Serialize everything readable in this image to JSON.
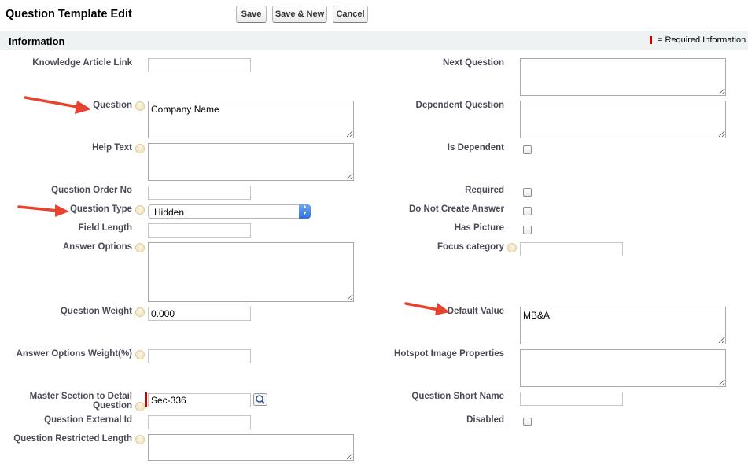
{
  "header": {
    "title": "Question Template Edit",
    "save_label": "Save",
    "save_new_label": "Save & New",
    "cancel_label": "Cancel"
  },
  "section": {
    "title": "Information",
    "required_legend": "= Required Information",
    "required_color": "#cc0000"
  },
  "left_fields": {
    "knowledge_article_link": {
      "label": "Knowledge Article Link",
      "value": ""
    },
    "question": {
      "label": "Question",
      "value": "Company Name"
    },
    "help_text": {
      "label": "Help Text",
      "value": ""
    },
    "question_order_no": {
      "label": "Question Order No",
      "value": ""
    },
    "question_type": {
      "label": "Question Type",
      "value": "Hidden"
    },
    "field_length": {
      "label": "Field Length",
      "value": ""
    },
    "answer_options": {
      "label": "Answer Options",
      "value": ""
    },
    "question_weight": {
      "label": "Question Weight",
      "value": "0.000"
    },
    "answer_options_weight": {
      "label": "Answer Options Weight(%)",
      "value": ""
    },
    "master_section_line1": "Master Section to Detail",
    "master_section_line2": "Question",
    "master_section_value": "Sec-336",
    "question_external_id": {
      "label": "Question External Id",
      "value": ""
    },
    "question_restricted_length": {
      "label": "Question Restricted Length",
      "value": ""
    }
  },
  "right_fields": {
    "next_question": {
      "label": "Next Question",
      "value": ""
    },
    "dependent_question": {
      "label": "Dependent Question",
      "value": ""
    },
    "is_dependent": {
      "label": "Is Dependent"
    },
    "required": {
      "label": "Required"
    },
    "do_not_create_answer": {
      "label": "Do Not Create Answer"
    },
    "has_picture": {
      "label": "Has Picture"
    },
    "focus_category": {
      "label": "Focus category",
      "value": ""
    },
    "default_value": {
      "label": "Default Value",
      "value": "MB&A"
    },
    "hotspot_image_properties": {
      "label": "Hotspot Image Properties",
      "value": ""
    },
    "question_short_name": {
      "label": "Question Short Name",
      "value": ""
    },
    "disabled": {
      "label": "Disabled"
    }
  },
  "icons": {
    "help": "help-icon",
    "lookup": "lookup-magnifier-icon",
    "annotation": "red-arrow-icon"
  },
  "colors": {
    "annotation_arrow": "#e8432f",
    "section_background": "#eef2f3",
    "label_text": "#4a4a56"
  }
}
